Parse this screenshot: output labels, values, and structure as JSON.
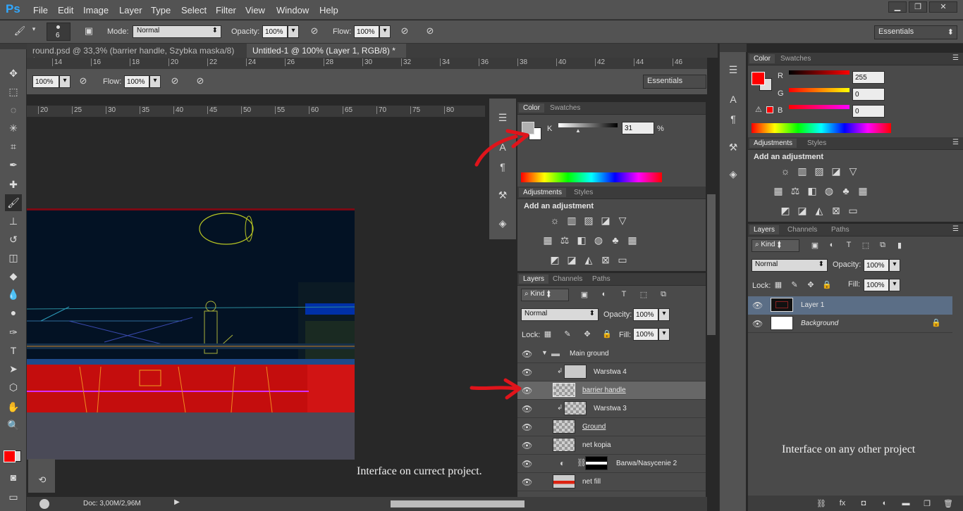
{
  "app": {
    "logo": "Ps"
  },
  "menu": [
    "File",
    "Edit",
    "Image",
    "Layer",
    "Type",
    "Select",
    "Filter",
    "View",
    "Window",
    "Help"
  ],
  "window_controls": [
    "minimize-icon",
    "restore-icon",
    "close-icon"
  ],
  "options_bar": {
    "brush_size": "6",
    "mode_label": "Mode:",
    "mode_value": "Normal",
    "opacity_label": "Opacity:",
    "opacity_value": "100%",
    "flow_label": "Flow:",
    "flow_value": "100%",
    "workspace": "Essentials"
  },
  "inner_options": {
    "zoom_value": "100%",
    "flow_label": "Flow:",
    "flow_value": "100%",
    "workspace": "Essentials"
  },
  "doc_tabs": [
    {
      "label": "round.psd @ 33,3% (barrier handle, Szybka maska/8) *",
      "close": "×"
    },
    {
      "label": "Untitled-1 @ 100% (Layer 1, RGB/8) *",
      "close": "×"
    }
  ],
  "top_ruler_ticks": [
    "14",
    "16",
    "18",
    "20",
    "22",
    "24",
    "26",
    "28",
    "30",
    "32",
    "34",
    "36",
    "38",
    "40",
    "42",
    "44",
    "46"
  ],
  "inner_ruler_ticks": [
    "20",
    "25",
    "30",
    "35",
    "40",
    "45",
    "50",
    "55",
    "60",
    "65",
    "70",
    "75",
    "80"
  ],
  "inner_color_panel": {
    "tabs": [
      "Color",
      "Swatches"
    ],
    "channel": "K",
    "value": "31",
    "unit": "%"
  },
  "inner_adjustments": {
    "tabs": [
      "Adjustments",
      "Styles"
    ],
    "title": "Add an adjustment"
  },
  "inner_layers": {
    "tabs": [
      "Layers",
      "Channels",
      "Paths"
    ],
    "kind": "Kind",
    "blend": "Normal",
    "opacity_label": "Opacity:",
    "opacity_value": "100%",
    "lock_label": "Lock:",
    "fill_label": "Fill:",
    "fill_value": "100%",
    "rows": [
      {
        "name": "Main ground",
        "type": "group"
      },
      {
        "name": "Warstwa 4",
        "type": "clipped"
      },
      {
        "name": "barrier handle",
        "type": "selected"
      },
      {
        "name": "Warstwa 3",
        "type": "clipped"
      },
      {
        "name": "Ground",
        "type": "layer"
      },
      {
        "name": "net kopia",
        "type": "layer"
      },
      {
        "name": "Barwa/Nasycenie 2",
        "type": "adjustment"
      },
      {
        "name": "net fill",
        "type": "layer"
      }
    ]
  },
  "inner_status": {
    "doc": "Doc: 3,00M/2,96M"
  },
  "annotations": {
    "current": "Interface on currect project.",
    "other": "Interface on any other project"
  },
  "right_color_panel": {
    "tabs": [
      "Color",
      "Swatches"
    ],
    "r_label": "R",
    "r_value": "255",
    "g_label": "G",
    "g_value": "0",
    "b_label": "B",
    "b_value": "0"
  },
  "right_adjustments": {
    "tabs": [
      "Adjustments",
      "Styles"
    ],
    "title": "Add an adjustment"
  },
  "right_layers": {
    "tabs": [
      "Layers",
      "Channels",
      "Paths"
    ],
    "kind": "Kind",
    "blend": "Normal",
    "opacity_label": "Opacity:",
    "opacity_value": "100%",
    "lock_label": "Lock:",
    "fill_label": "Fill:",
    "fill_value": "100%",
    "rows": [
      {
        "name": "Layer 1"
      },
      {
        "name": "Background"
      }
    ]
  },
  "colors": {
    "foreground": "#ff0000",
    "accent": "#31a8ff",
    "arrow": "#e0141b"
  }
}
